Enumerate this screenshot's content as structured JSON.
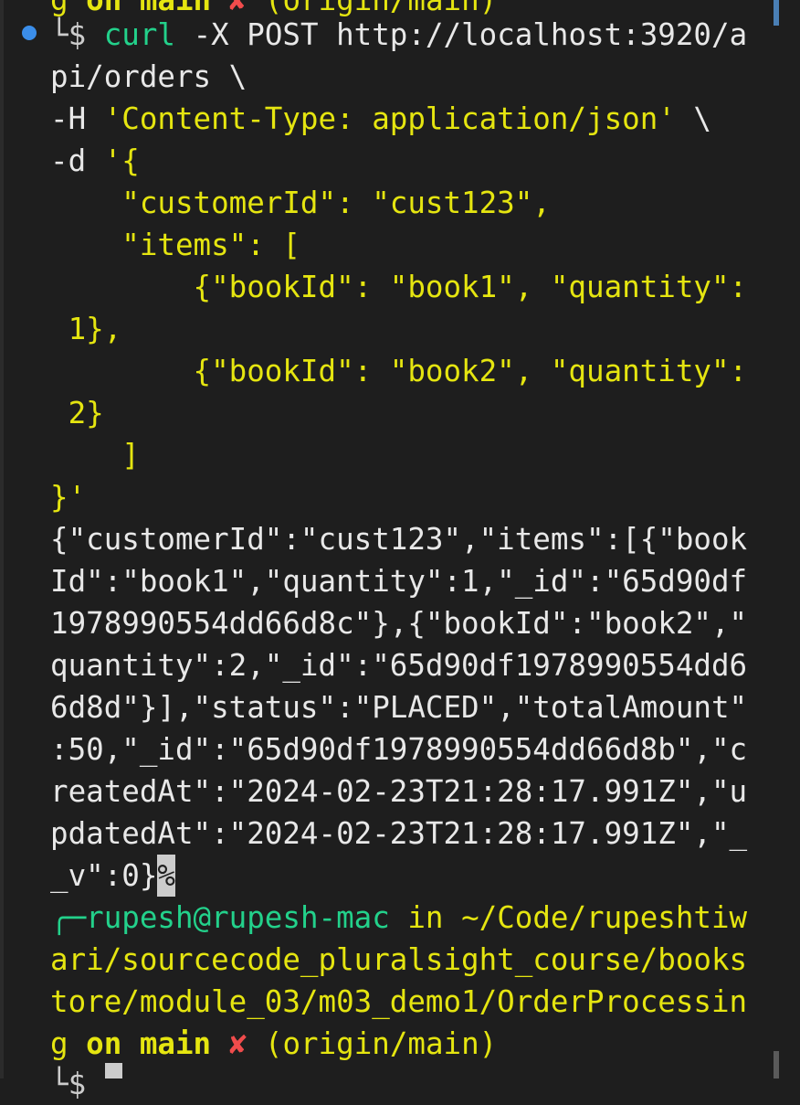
{
  "terminal": {
    "top_partial": {
      "prefix": "g ",
      "on": "on",
      "branch": "main",
      "dirty": "✘",
      "remote": "(origin/main)"
    },
    "prompt_char": "└$",
    "command": {
      "name": "curl",
      "args_line1": " -X POST http://localhost:3920/a",
      "line2": "pi/orders \\",
      "line3": "-H 'Content-Type: application/json' \\",
      "line4": "-d '{",
      "line5": "    \"customerId\": \"cust123\",",
      "line6": "    \"items\": [",
      "line7": "        {\"bookId\": \"book1\", \"quantity\":",
      "line8": " 1},",
      "line9": "        {\"bookId\": \"book2\", \"quantity\":",
      "line10": " 2}",
      "line11": "    ]",
      "line12": "}'"
    },
    "output": [
      "{\"customerId\":\"cust123\",\"items\":[{\"book",
      "Id\":\"book1\",\"quantity\":1,\"_id\":\"65d90df",
      "1978990554dd66d8c\"},{\"bookId\":\"book2\",\"",
      "quantity\":2,\"_id\":\"65d90df1978990554dd6",
      "6d8d\"}],\"status\":\"PLACED\",\"totalAmount\"",
      ":50,\"_id\":\"65d90df1978990554dd66d8b\",\"c",
      "reatedAt\":\"2024-02-23T21:28:17.991Z\",\"u",
      "pdatedAt\":\"2024-02-23T21:28:17.991Z\",\"_"
    ],
    "output_last": "_v\":0}",
    "percent": "%",
    "prompt2": {
      "corner": "╭─",
      "user_host": "rupesh@rupesh-mac",
      "in": " in ",
      "path_line1": "~/Code/rupeshtiw",
      "path_line2": "ari/sourcecode_pluralsight_course/books",
      "path_line3": "tore/module_03/m03_demo1/OrderProcessin",
      "path_line4_start": "g ",
      "on": "on",
      "branch": "main",
      "dirty": "✘",
      "remote": "(origin/main)"
    },
    "prompt_char_bottom": "└$"
  }
}
